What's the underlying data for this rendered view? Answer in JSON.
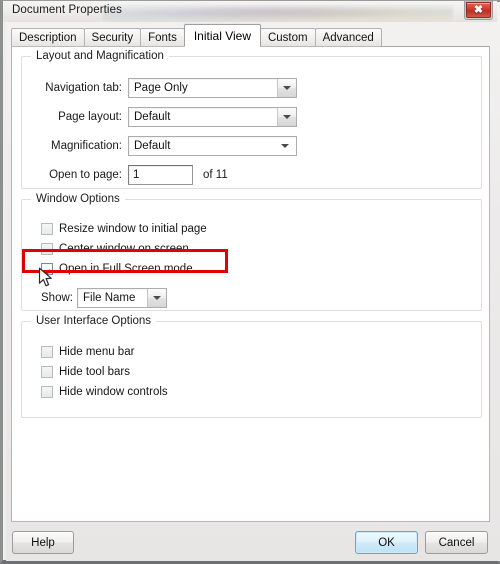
{
  "window": {
    "title": "Document Properties",
    "close_icon": "close-icon",
    "close_glyph": "✖"
  },
  "tabs": [
    {
      "label": "Description",
      "active": false
    },
    {
      "label": "Security",
      "active": false
    },
    {
      "label": "Fonts",
      "active": false
    },
    {
      "label": "Initial View",
      "active": true
    },
    {
      "label": "Custom",
      "active": false
    },
    {
      "label": "Advanced",
      "active": false
    }
  ],
  "layout_group": {
    "title": "Layout and Magnification",
    "navigation_tab": {
      "label": "Navigation tab:",
      "value": "Page Only",
      "arrow_icon": "chevron-down-icon"
    },
    "page_layout": {
      "label": "Page layout:",
      "value": "Default",
      "arrow_icon": "chevron-down-icon"
    },
    "magnification": {
      "label": "Magnification:",
      "value": "Default",
      "arrow_icon": "chevron-down-icon"
    },
    "open_to_page": {
      "label": "Open to page:",
      "value": "1",
      "placeholder": "",
      "suffix": "of 11"
    }
  },
  "window_group": {
    "title": "Window Options",
    "checkboxes": [
      {
        "label": "Resize window to initial page",
        "checked": false
      },
      {
        "label": "Center window on screen",
        "checked": false
      },
      {
        "label": "Open in Full Screen mode",
        "checked": true
      }
    ],
    "show": {
      "label": "Show:",
      "value": "File Name",
      "arrow_icon": "chevron-down-icon"
    }
  },
  "ui_group": {
    "title": "User Interface Options",
    "checkboxes": [
      {
        "label": "Hide menu bar",
        "checked": false
      },
      {
        "label": "Hide tool bars",
        "checked": false
      },
      {
        "label": "Hide window controls",
        "checked": false
      }
    ]
  },
  "footer": {
    "help_label": "Help",
    "ok_label": "OK",
    "cancel_label": "Cancel"
  },
  "annotation": {
    "highlight_color": "#e00000",
    "target": "Open in Full Screen mode"
  },
  "colors": {
    "dialog_bg": "#efeeee",
    "panel_bg": "#ffffff",
    "accent_focus": "#5ea8d8",
    "close_red": "#cf3a2c",
    "check_blue": "#2a64a5"
  }
}
